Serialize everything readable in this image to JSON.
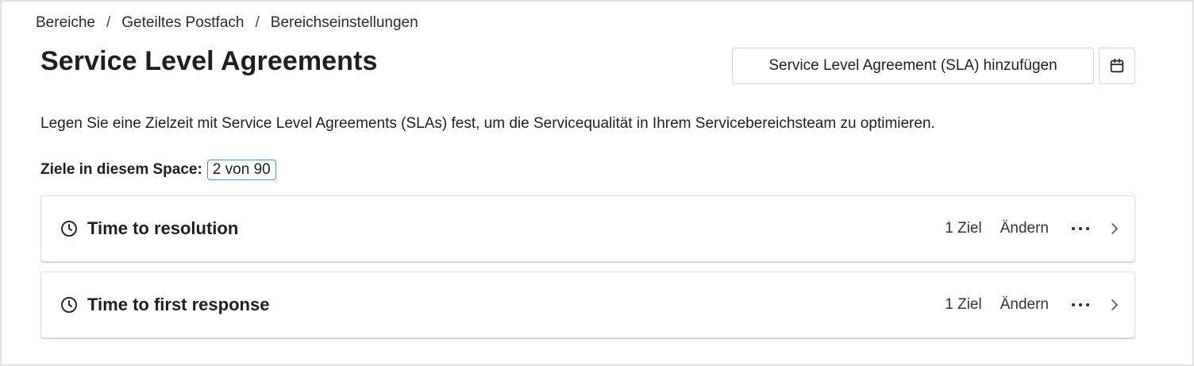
{
  "breadcrumb": {
    "items": [
      "Bereiche",
      "Geteiltes Postfach",
      "Bereichseinstellungen"
    ],
    "separator": "/"
  },
  "header": {
    "title": "Service Level Agreements",
    "add_button_label": "Service Level Agreement (SLA) hinzufügen",
    "calendar_icon": "calendar-icon"
  },
  "intro": {
    "description": "Legen Sie eine Zielzeit mit Service Level Agreements (SLAs) fest, um die Servicequalität in Ihrem Servicebereichsteam zu optimieren."
  },
  "goals": {
    "label": "Ziele in diesem Space:",
    "count": "2 von 90"
  },
  "slas": [
    {
      "title": "Time to resolution",
      "goal_count": "1 Ziel",
      "edit_label": "Ändern",
      "icon": "clock-icon"
    },
    {
      "title": "Time to first response",
      "goal_count": "1 Ziel",
      "edit_label": "Ändern",
      "icon": "clock-icon"
    }
  ],
  "colors": {
    "goals_count_border": "#4a90e2",
    "card_border": "#dcdfe4",
    "text": "#1f1f1f"
  }
}
